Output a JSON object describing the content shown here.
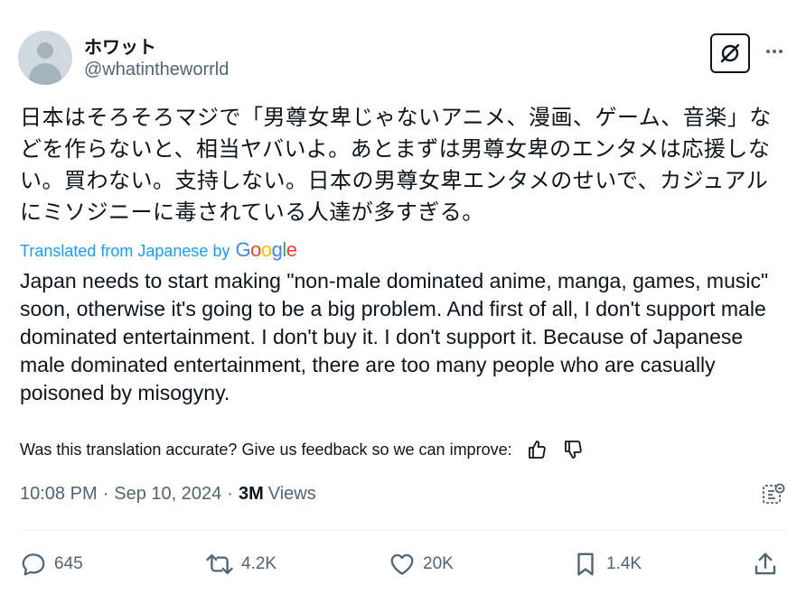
{
  "author": {
    "display_name": "ホワット",
    "handle": "@whatintheworrld"
  },
  "tweet": {
    "original_text": "日本はそろそろマジで「男尊女卑じゃないアニメ、漫画、ゲーム、音楽」などを作らないと、相当ヤバいよ。あとまずは男尊女卑のエンタメは応援しない。買わない。支持しない。日本の男尊女卑エンタメのせいで、カジュアルにミソジニーに毒されている人達が多すぎる。",
    "translated_label": "Translated from Japanese by",
    "google_brand": [
      "G",
      "o",
      "o",
      "g",
      "l",
      "e"
    ],
    "translated_text": "Japan needs to start making \"non-male dominated anime, manga, games, music\" soon, otherwise it's going to be a big problem. And first of all, I don't support male dominated entertainment. I don't buy it. I don't support it. Because of Japanese male dominated entertainment, there are too many people who are casually poisoned by misogyny.",
    "feedback_prompt": "Was this translation accurate? Give us feedback so we can improve:",
    "time": "10:08 PM",
    "separator": "·",
    "date": "Sep 10, 2024",
    "views_count": "3M",
    "views_label": "Views"
  },
  "actions": {
    "replies": "645",
    "reposts": "4.2K",
    "likes": "20K",
    "bookmarks": "1.4K"
  },
  "icons": {
    "grok": "grok-icon",
    "more": "more-icon",
    "thumbs_up": "thumbs-up-icon",
    "thumbs_down": "thumbs-down-icon",
    "analytics": "analytics-icon",
    "reply": "reply-icon",
    "repost": "repost-icon",
    "like": "heart-icon",
    "bookmark": "bookmark-icon",
    "share": "share-icon"
  },
  "colors": {
    "text_primary": "#0f1419",
    "text_secondary": "#536471",
    "link_blue": "#1d9bf0"
  }
}
